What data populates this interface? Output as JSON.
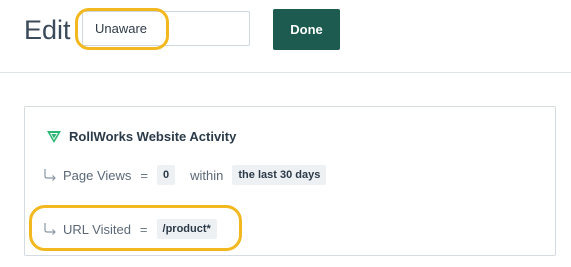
{
  "header": {
    "title": "Edit",
    "name_input_value": "Unaware",
    "done_label": "Done"
  },
  "card": {
    "source": {
      "title": "RollWorks Website Activity",
      "icon": "rollworks-logo-icon",
      "icon_color": "#2bb673"
    },
    "rules": [
      {
        "field": "Page Views",
        "operator": "=",
        "value": "0",
        "qualifier": "within",
        "qualifier_value": "the last 30 days"
      },
      {
        "field": "URL Visited",
        "operator": "=",
        "value": "/product*"
      }
    ]
  },
  "colors": {
    "highlight": "#f3b81f",
    "done_button": "#1d5a4f"
  }
}
